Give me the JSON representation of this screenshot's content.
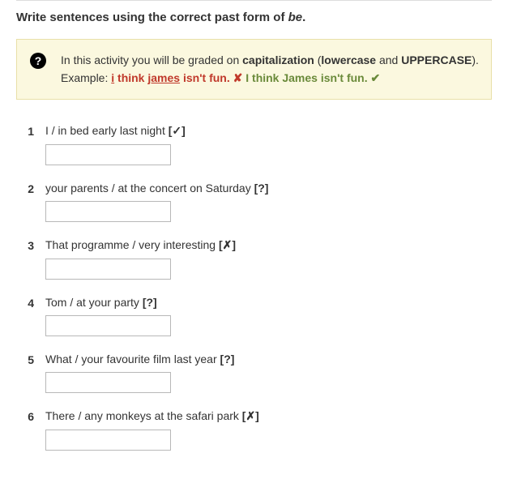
{
  "instruction": {
    "prefix": "Write sentences using the correct past form of ",
    "italic": "be",
    "suffix": "."
  },
  "info": {
    "line1_pre": "In this activity you will be graded on ",
    "cap": "capitalization",
    "paren_open": " (",
    "lowercase": "lowercase",
    "and": " and ",
    "uppercase": "UPPERCASE",
    "paren_close": ").",
    "example_label": "Example: ",
    "wrong_i": "i",
    "wrong_think": " think ",
    "wrong_james": "james",
    "wrong_rest": " isn't fun. ",
    "cross": "✘",
    "gap": "  ",
    "right": "I think James isn't fun. ",
    "check": "✔"
  },
  "questions": [
    {
      "num": "1",
      "prompt": "I / in bed early last night ",
      "marker": "[✓]",
      "value": ""
    },
    {
      "num": "2",
      "prompt": "your parents / at the concert on Saturday ",
      "marker": "[?]",
      "value": ""
    },
    {
      "num": "3",
      "prompt": "That programme / very interesting ",
      "marker": "[✗]",
      "value": ""
    },
    {
      "num": "4",
      "prompt": "Tom / at your party ",
      "marker": "[?]",
      "value": ""
    },
    {
      "num": "5",
      "prompt": "What / your favourite film last year ",
      "marker": "[?]",
      "value": ""
    },
    {
      "num": "6",
      "prompt": "There / any monkeys at the safari park ",
      "marker": "[✗]",
      "value": ""
    }
  ]
}
